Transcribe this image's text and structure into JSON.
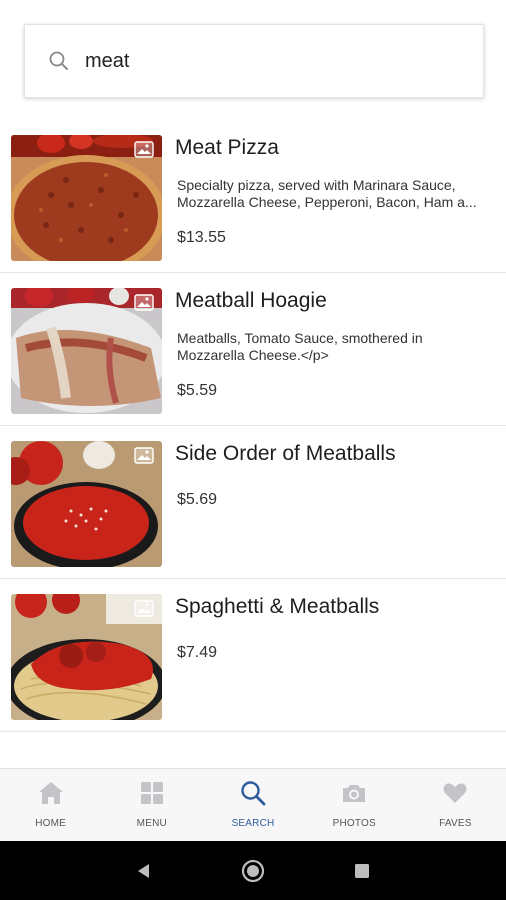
{
  "search": {
    "value": "meat",
    "placeholder": "Search"
  },
  "results": [
    {
      "title": "Meat Pizza",
      "description": "Specialty pizza, served with Marinara Sauce, Mozzarella Cheese, Pepperoni, Bacon, Ham a...",
      "price": "$13.55",
      "image": "pizza-photo"
    },
    {
      "title": "Meatball Hoagie",
      "description": "Meatballs, Tomato Sauce, smothered in Mozzarella Cheese.</p>",
      "price": "$5.59",
      "image": "hoagie-photo"
    },
    {
      "title": "Side Order of Meatballs",
      "description": "",
      "price": "$5.69",
      "image": "meatballs-photo"
    },
    {
      "title": "Spaghetti & Meatballs",
      "description": "",
      "price": "$7.49",
      "image": "spaghetti-photo"
    }
  ],
  "nav": {
    "items": [
      {
        "label": "HOME",
        "icon": "home-icon",
        "active": false
      },
      {
        "label": "MENU",
        "icon": "grid-icon",
        "active": false
      },
      {
        "label": "SEARCH",
        "icon": "search-icon",
        "active": true
      },
      {
        "label": "PHOTOS",
        "icon": "camera-icon",
        "active": false
      },
      {
        "label": "FAVES",
        "icon": "heart-icon",
        "active": false
      }
    ]
  },
  "colors": {
    "accent": "#2f5c9c",
    "nav_inactive_icon": "#c4c4c8",
    "nav_background": "#f7f7f8"
  }
}
